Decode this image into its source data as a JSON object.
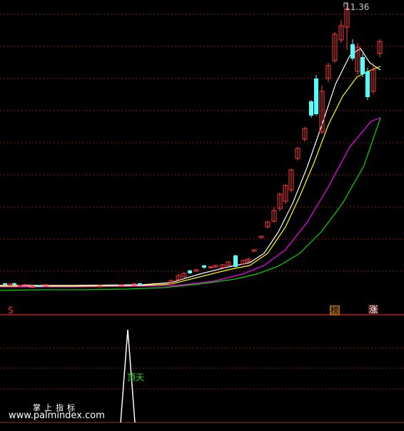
{
  "chart": {
    "peak_price": "11.36",
    "buy_marker": "S",
    "tag_bang": "榜",
    "tag_zhang": "涨",
    "indicator_label": "顶天",
    "colors": {
      "background": "#000000",
      "grid": "#8b1a1a",
      "divider": "#b82020",
      "up_candle": "#ff3b3b",
      "down_candle": "#54ffff",
      "ma_short": "#ffffff",
      "ma_mid": "#ffff00",
      "ma_long": "#ff00ff",
      "ma_longest": "#00d800",
      "indicator_line": "#ffffff"
    }
  },
  "watermark": {
    "title": "掌上指标",
    "url": "www.palmindex.com"
  }
}
